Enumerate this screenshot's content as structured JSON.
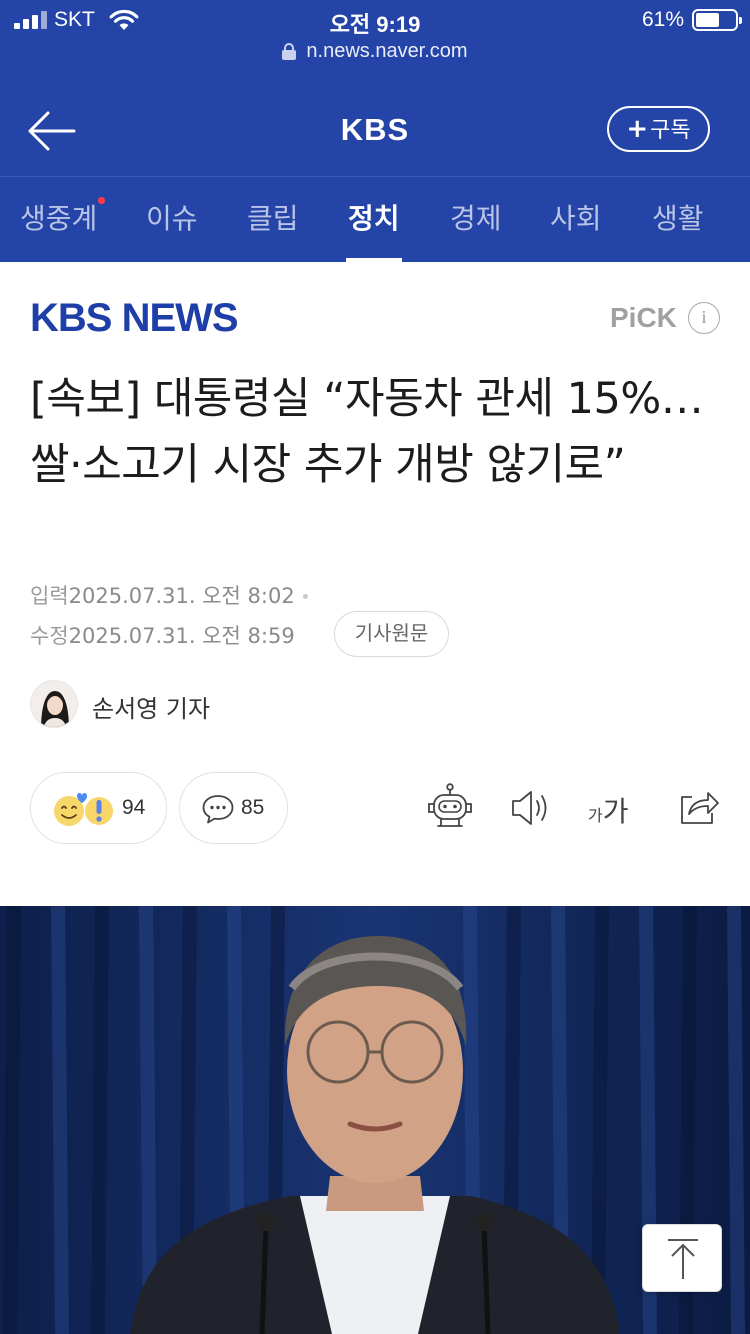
{
  "status_bar": {
    "carrier": "SKT",
    "time": "오전 9:19",
    "battery_percent": "61%",
    "battery_level": 0.61
  },
  "browser": {
    "url": "n.news.naver.com"
  },
  "header": {
    "title": "KBS",
    "subscribe_label": "구독"
  },
  "tabs": [
    {
      "label": "생중계",
      "active": false,
      "has_dot": true
    },
    {
      "label": "이슈",
      "active": false
    },
    {
      "label": "클립",
      "active": false
    },
    {
      "label": "정치",
      "active": true
    },
    {
      "label": "경제",
      "active": false
    },
    {
      "label": "사회",
      "active": false
    },
    {
      "label": "생활",
      "active": false
    }
  ],
  "article": {
    "press_logo_text": "KBS NEWS",
    "pick_label": "PiCK",
    "info_symbol": "i",
    "headline": "[속보] 대통령실 “자동차 관세 15%…쌀·소고기 시장 추가 개방 않기로”",
    "input_label": "입력",
    "input_datetime": "2025.07.31. 오전 8:02",
    "modified_label": "수정",
    "modified_datetime": "2025.07.31. 오전 8:59",
    "original_button": "기사원문",
    "reporter": "손서영 기자",
    "reaction_count": "94",
    "comment_count": "85",
    "font_size_small": "가",
    "font_size_big": "가"
  },
  "colors": {
    "header_blue": "#2445a7",
    "press_logo_blue": "#1f3fa8",
    "live_dot": "#ff3b44"
  }
}
